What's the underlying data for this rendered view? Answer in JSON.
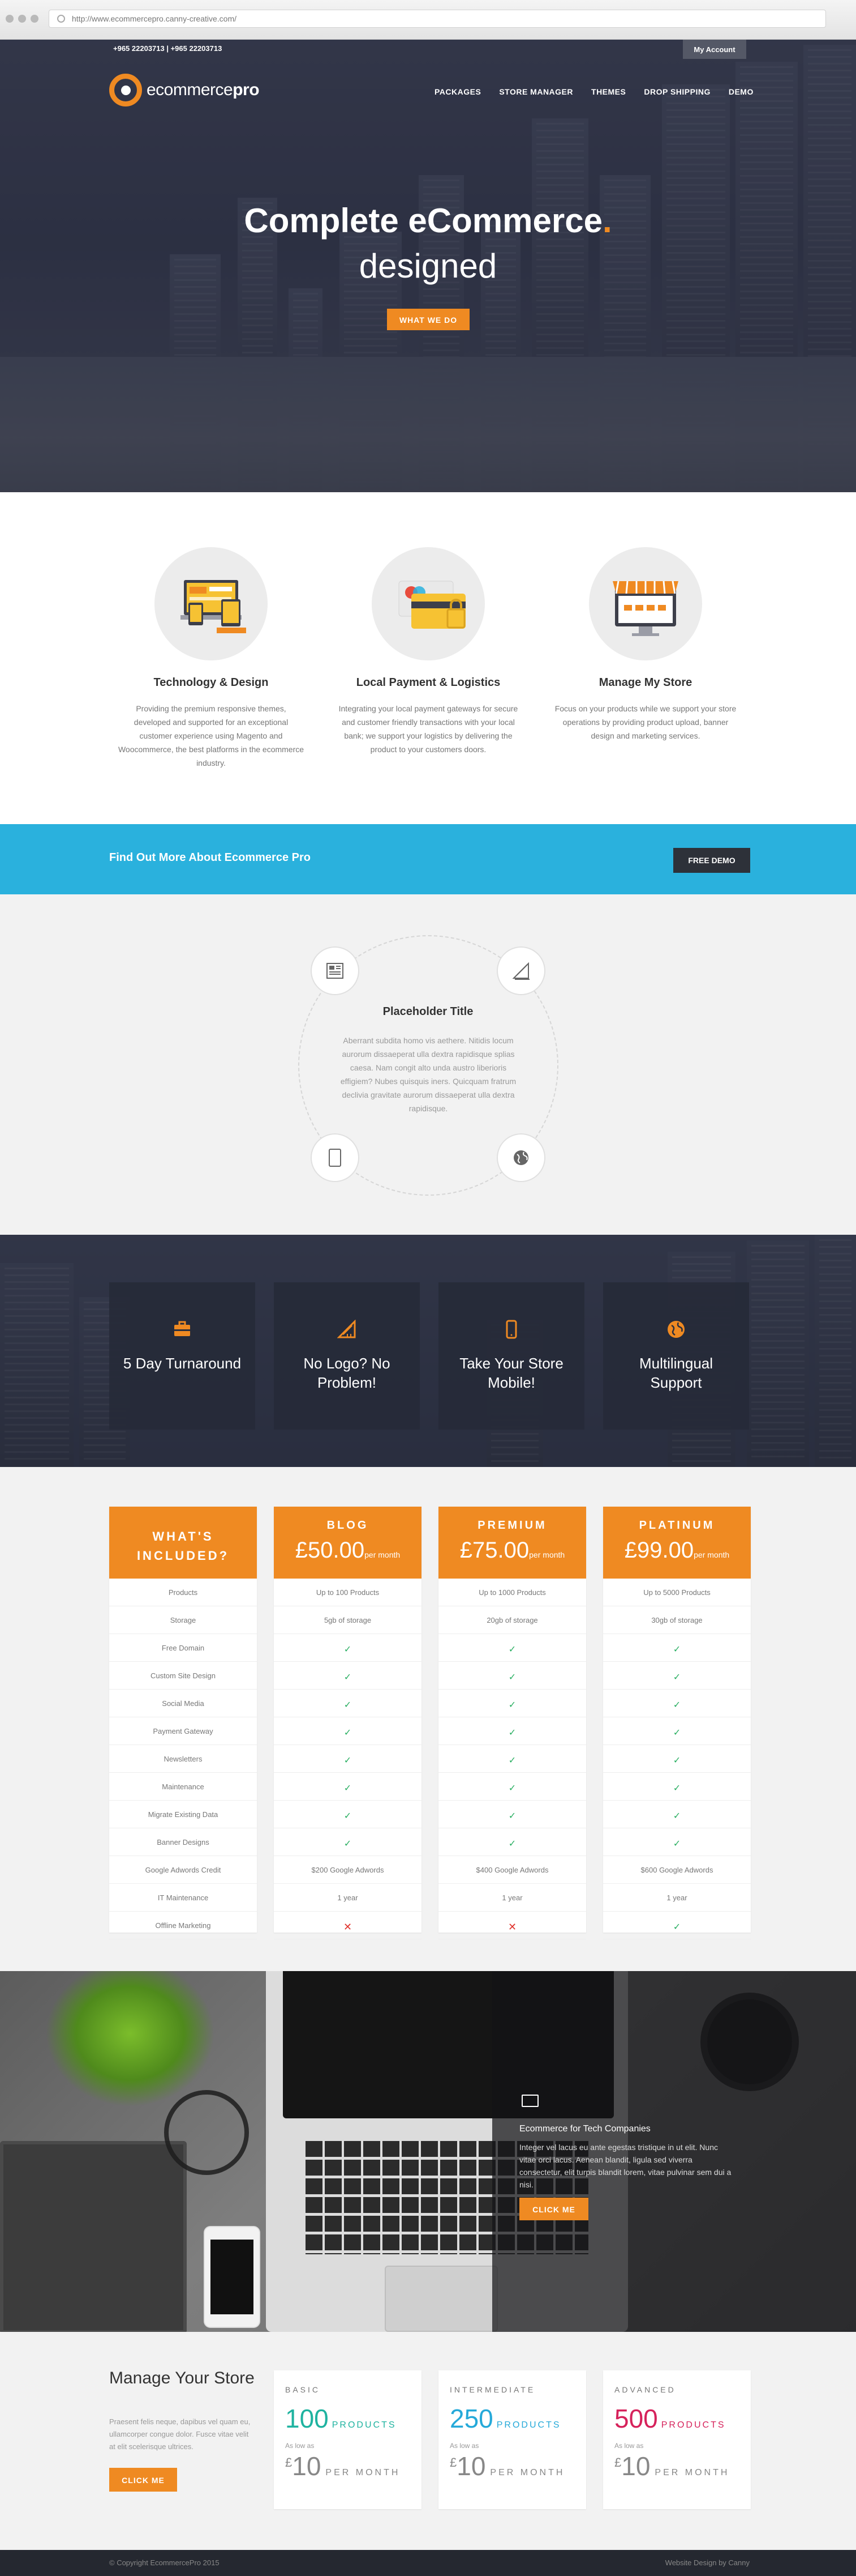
{
  "browser": {
    "url": "http://www.ecommercepro.canny-creative.com/"
  },
  "topbar": {
    "phones": "+965 22203713  |  +965 22203713",
    "account": "My Account"
  },
  "logo": {
    "text_light": "ecommerce",
    "text_bold": "pro"
  },
  "nav": [
    "PACKAGES",
    "STORE MANAGER",
    "THEMES",
    "DROP SHIPPING",
    "DEMO"
  ],
  "hero": {
    "title": "Complete eCommerce",
    "title_dot": ".",
    "subtitle": "designed",
    "button": "WHAT WE DO"
  },
  "features": [
    {
      "icon": "devices-icon",
      "title": "Technology & Design",
      "text": "Providing the premium responsive themes, developed and supported for an exceptional customer experience using Magento and Woocommerce, the best platforms in the ecommerce industry."
    },
    {
      "icon": "payment-cards-icon",
      "title": "Local Payment & Logistics",
      "text": "Integrating your local payment gateways for secure and customer friendly transactions with your local bank; we support your logistics by delivering the product to your customers doors."
    },
    {
      "icon": "store-icon",
      "title": "Manage My Store",
      "text": "Focus on your products while we support your store operations by providing product upload, banner design and marketing services."
    }
  ],
  "band": {
    "text": "Find Out More About Ecommerce Pro",
    "button": "FREE DEMO"
  },
  "placeholder": {
    "title": "Placeholder Title",
    "text": "Aberrant subdita homo vis aethere. Nitidis locum aurorum dissaeperat ulla dextra rapidisque splias caesa. Nam congit alto unda austro liberioris effigiem? Nubes quisquis iners. Quicquam fratrum declivia gravitate aurorum dissaeperat ulla dextra rapidisque.",
    "icons": [
      "newspaper-icon",
      "design-tools-icon",
      "tablet-icon",
      "globe-icon"
    ]
  },
  "benefits": [
    {
      "icon": "briefcase-icon",
      "text": "5 Day Turnaround"
    },
    {
      "icon": "design-tools-icon",
      "text": "No Logo? No Problem!"
    },
    {
      "icon": "mobile-icon",
      "text": "Take Your Store Mobile!"
    },
    {
      "icon": "globe-icon",
      "text": "Multilingual Support"
    }
  ],
  "pricing": {
    "included_header": "WHAT'S INCLUDED?",
    "features": [
      "Products",
      "Storage",
      "Free Domain",
      "Custom Site Design",
      "Social Media",
      "Payment Gateway",
      "Newsletters",
      "Maintenance",
      "Migrate Existing Data",
      "Banner Designs",
      "Google Adwords Credit",
      "IT Maintenance",
      "Offline Marketing"
    ],
    "plans": [
      {
        "name": "BLOG",
        "price": "£50.00",
        "per": "per month",
        "cells": [
          "Up to 100 Products",
          "5gb of storage",
          "✓",
          "✓",
          "✓",
          "✓",
          "✓",
          "✓",
          "✓",
          "✓",
          "$200 Google Adwords",
          "1 year",
          "✕"
        ]
      },
      {
        "name": "PREMIUM",
        "price": "£75.00",
        "per": "per month",
        "cells": [
          "Up to 1000 Products",
          "20gb of storage",
          "✓",
          "✓",
          "✓",
          "✓",
          "✓",
          "✓",
          "✓",
          "✓",
          "$400 Google Adwords",
          "1 year",
          "✕"
        ]
      },
      {
        "name": "PLATINUM",
        "price": "£99.00",
        "per": "per month",
        "cells": [
          "Up to 5000 Products",
          "30gb of storage",
          "✓",
          "✓",
          "✓",
          "✓",
          "✓",
          "✓",
          "✓",
          "✓",
          "$600 Google Adwords",
          "1 year",
          "✓"
        ]
      }
    ]
  },
  "promo": {
    "icon": "monitor-icon",
    "title": "Ecommerce for Tech Companies",
    "text": "Integer vel lacus eu ante egestas tristique in ut elit. Nunc vitae orci lacus. Aenean blandit, ligula sed viverra consectetur, elit turpis blandit lorem, vitae pulvinar sem dui a nisi.",
    "button": "CLICK ME"
  },
  "manage": {
    "title": "Manage Your Store",
    "text": "Praesent felis neque, dapibus vel quam eu, ullamcorper congue dolor. Fusce vitae velit at elit scelerisque ultrices.",
    "button": "CLICK ME",
    "cards": [
      {
        "name": "BASIC",
        "number": "100",
        "unit": "PRODUCTS",
        "color": "#1fb3a0",
        "as_low": "As low as",
        "currency": "£",
        "price": "10",
        "per": "PER MONTH"
      },
      {
        "name": "INTERMEDIATE",
        "number": "250",
        "unit": "PRODUCTS",
        "color": "#25a9d9",
        "as_low": "As low as",
        "currency": "£",
        "price": "10",
        "per": "PER MONTH"
      },
      {
        "name": "ADVANCED",
        "number": "500",
        "unit": "PRODUCTS",
        "color": "#d6225b",
        "as_low": "As low as",
        "currency": "£",
        "price": "10",
        "per": "PER MONTH"
      }
    ]
  },
  "footer": {
    "copyright": "© Copyright EcommercePro 2015",
    "credit": "Website Design by Canny"
  },
  "colors": {
    "accent": "#ef8a22",
    "band": "#2ab1dd",
    "tick": "#27ae60",
    "cross": "#e0322b"
  }
}
